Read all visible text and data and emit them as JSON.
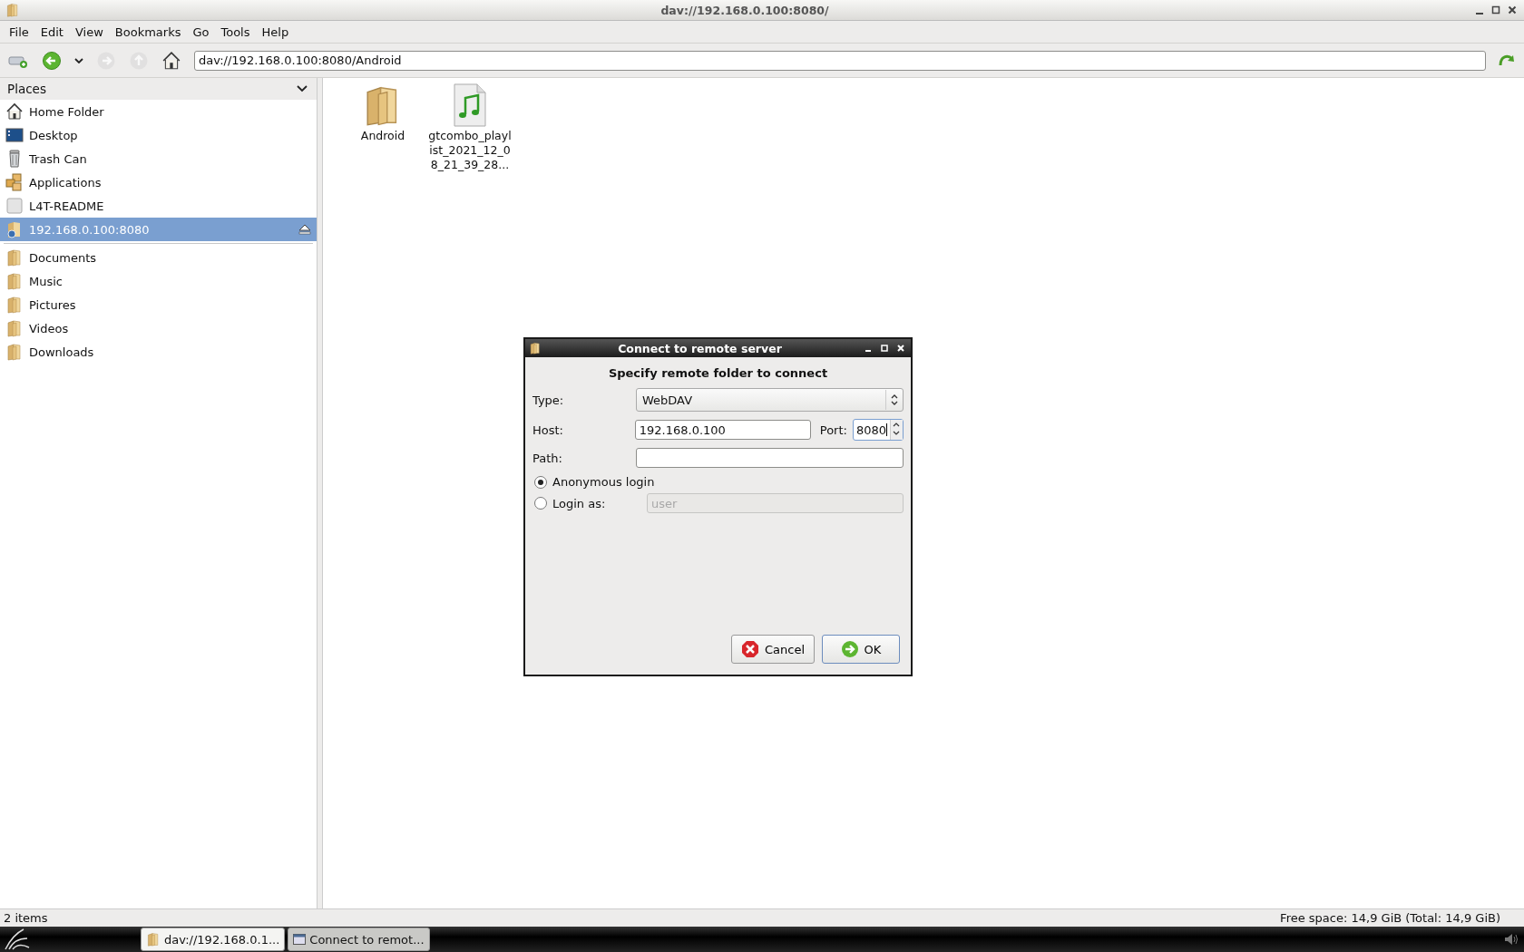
{
  "window": {
    "title": "dav://192.168.0.100:8080/"
  },
  "menu": [
    "File",
    "Edit",
    "View",
    "Bookmarks",
    "Go",
    "Tools",
    "Help"
  ],
  "toolbar": [
    {
      "kind": "new-tab",
      "disabled": false
    },
    {
      "kind": "back",
      "disabled": false
    },
    {
      "kind": "history",
      "disabled": false
    },
    {
      "kind": "forward",
      "disabled": true
    },
    {
      "kind": "up",
      "disabled": true
    },
    {
      "kind": "home",
      "disabled": false
    }
  ],
  "address": "dav://192.168.0.100:8080/Android",
  "sidebar": {
    "title": "Places",
    "places": [
      {
        "label": "Home Folder",
        "kind": "home",
        "selected": false,
        "ejectable": false
      },
      {
        "label": "Desktop",
        "kind": "desktop",
        "selected": false,
        "ejectable": false
      },
      {
        "label": "Trash Can",
        "kind": "trash",
        "selected": false,
        "ejectable": false
      },
      {
        "label": "Applications",
        "kind": "applications",
        "selected": false,
        "ejectable": false
      },
      {
        "label": "L4T-README",
        "kind": "drive",
        "selected": false,
        "ejectable": false
      },
      {
        "label": "192.168.0.100:8080",
        "kind": "network",
        "selected": true,
        "ejectable": true
      }
    ],
    "bookmarks": [
      {
        "label": "Documents",
        "kind": "folder",
        "selected": false
      },
      {
        "label": "Music",
        "kind": "folder",
        "selected": false
      },
      {
        "label": "Pictures",
        "kind": "folder",
        "selected": false
      },
      {
        "label": "Videos",
        "kind": "folder",
        "selected": false
      },
      {
        "label": "Downloads",
        "kind": "folder",
        "selected": false
      }
    ]
  },
  "files": [
    {
      "name": "Android",
      "kind": "folder"
    },
    {
      "name": "gtcombo_playlist_2021_12_08_21_39_28...",
      "kind": "audio"
    }
  ],
  "status_bar": {
    "items": "2 items",
    "free_space": "Free space: 14,9 GiB (Total: 14,9 GiB)"
  },
  "dialog": {
    "title": "Connect to remote server",
    "heading": "Specify remote folder to connect",
    "type_label": "Type:",
    "type_value": "WebDAV",
    "host_label": "Host:",
    "host_value": "192.168.0.100",
    "port_label": "Port:",
    "port_value": "8080",
    "path_label": "Path:",
    "login_options": [
      {
        "label": "Anonymous login",
        "selected": true
      },
      {
        "label": "Login as:",
        "selected": false
      }
    ],
    "user_placeholder": "user",
    "buttons": [
      {
        "label": "Cancel",
        "kind": "cancel"
      },
      {
        "label": "OK",
        "kind": "ok"
      }
    ]
  },
  "taskbar": [
    {
      "label": "dav://192.168.0.1...",
      "kind": "folder",
      "selected": false
    },
    {
      "label": "Connect to remot...",
      "kind": "window",
      "selected": true
    }
  ]
}
